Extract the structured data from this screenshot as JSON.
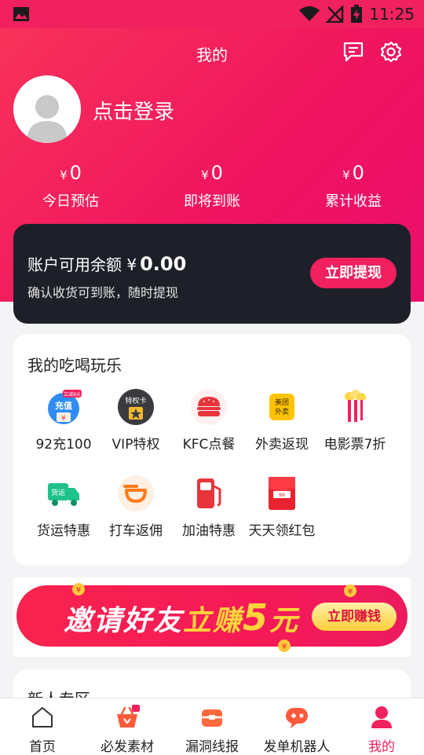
{
  "status_bar": {
    "time": "11:25"
  },
  "header": {
    "title": "我的",
    "login_text": "点击登录"
  },
  "stats": [
    {
      "currency": "¥",
      "value": "0",
      "label": "今日预估"
    },
    {
      "currency": "¥",
      "value": "0",
      "label": "即将到账"
    },
    {
      "currency": "¥",
      "value": "0",
      "label": "累计收益"
    }
  ],
  "balance": {
    "label": "账户可用余额",
    "currency": "¥",
    "amount": "0.00",
    "subtitle": "确认收货可到账，随时提现",
    "withdraw_label": "立即提现"
  },
  "services": {
    "title": "我的吃喝玩乐",
    "items": [
      {
        "label": "92充100",
        "icon": "recharge-icon",
        "badge": "立减8元",
        "icon_text": "充值"
      },
      {
        "label": "VIP特权",
        "icon": "vip-card-icon",
        "icon_text": "特权卡"
      },
      {
        "label": "KFC点餐",
        "icon": "burger-icon"
      },
      {
        "label": "外卖返现",
        "icon": "meituan-takeout-icon",
        "icon_text": "美团外卖"
      },
      {
        "label": "电影票7折",
        "icon": "popcorn-icon"
      },
      {
        "label": "货运特惠",
        "icon": "truck-icon",
        "icon_text": "货运"
      },
      {
        "label": "打车返佣",
        "icon": "didi-taxi-icon"
      },
      {
        "label": "加油特惠",
        "icon": "fuel-pump-icon"
      },
      {
        "label": "天天领红包",
        "icon": "red-envelope-icon"
      }
    ]
  },
  "banner": {
    "text_part1": "邀请好友",
    "text_part2": "立赚",
    "text_amount": "5",
    "text_unit": "元",
    "button_label": "立即赚钱"
  },
  "newbie": {
    "title": "新人专区"
  },
  "bottom_nav": [
    {
      "label": "首页",
      "icon": "home-icon",
      "active": false
    },
    {
      "label": "必发素材",
      "icon": "basket-icon",
      "active": false
    },
    {
      "label": "漏洞线报",
      "icon": "box-icon",
      "active": false
    },
    {
      "label": "发单机器人",
      "icon": "robot-icon",
      "active": false
    },
    {
      "label": "我的",
      "icon": "person-icon",
      "active": true
    }
  ],
  "colors": {
    "accent": "#f1205f",
    "dark_card": "#1e2029"
  }
}
